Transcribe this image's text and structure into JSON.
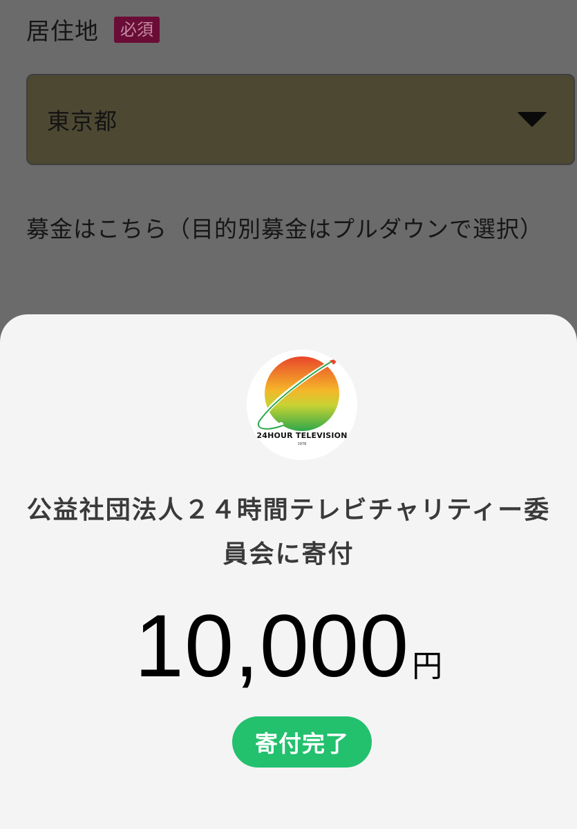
{
  "form": {
    "residence_label": "居住地",
    "required_badge": "必須",
    "residence_value": "東京都",
    "fund_label": "募金はこちら（目的別募金はプルダウンで選択）"
  },
  "sheet": {
    "logo": {
      "icon": "24hour-television-logo-icon",
      "text": "24HOUR TELEVISION",
      "sub": "1978"
    },
    "donee_line1": "公益社団法人２４時間テレビチャリティー委",
    "donee_line2": "員会に寄付",
    "amount": "10,000",
    "currency": "円",
    "status": "寄付完了"
  },
  "colors": {
    "accent_green": "#23c06e",
    "required_badge": "#6a0d36",
    "sheet_background": "#f4f4f4",
    "overlay": "#6b6b6b"
  }
}
